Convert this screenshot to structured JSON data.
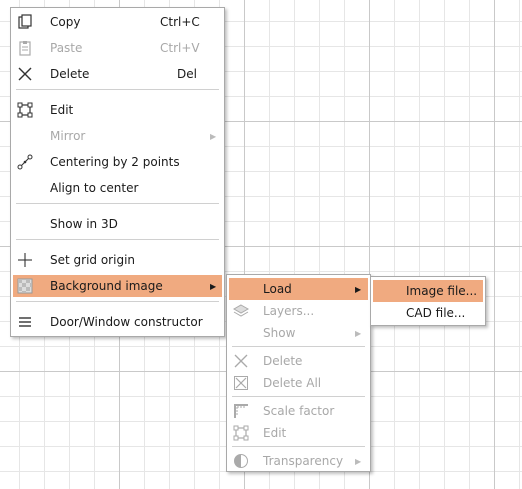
{
  "menu1": {
    "copy": {
      "label": "Copy",
      "shortcut": "Ctrl+C"
    },
    "paste": {
      "label": "Paste",
      "shortcut": "Ctrl+V"
    },
    "delete": {
      "label": "Delete",
      "shortcut": "Del"
    },
    "edit": {
      "label": "Edit"
    },
    "mirror": {
      "label": "Mirror"
    },
    "centering": {
      "label": "Centering by 2 points"
    },
    "align": {
      "label": "Align to center"
    },
    "show3d": {
      "label": "Show in 3D"
    },
    "grid_origin": {
      "label": "Set grid origin"
    },
    "background": {
      "label": "Background image"
    },
    "constructor": {
      "label": "Door/Window constructor"
    }
  },
  "menu2": {
    "load": {
      "label": "Load"
    },
    "layers": {
      "label": "Layers..."
    },
    "show": {
      "label": "Show"
    },
    "delete": {
      "label": "Delete"
    },
    "delete_all": {
      "label": "Delete All"
    },
    "scale": {
      "label": "Scale factor"
    },
    "edit": {
      "label": "Edit"
    },
    "transparency": {
      "label": "Transparency"
    }
  },
  "menu3": {
    "image_file": {
      "label": "Image file..."
    },
    "cad_file": {
      "label": "CAD file..."
    }
  },
  "colors": {
    "highlight": "#f0aa80",
    "disabled_text": "#a8a8a8",
    "separator": "#d0d0d0"
  }
}
